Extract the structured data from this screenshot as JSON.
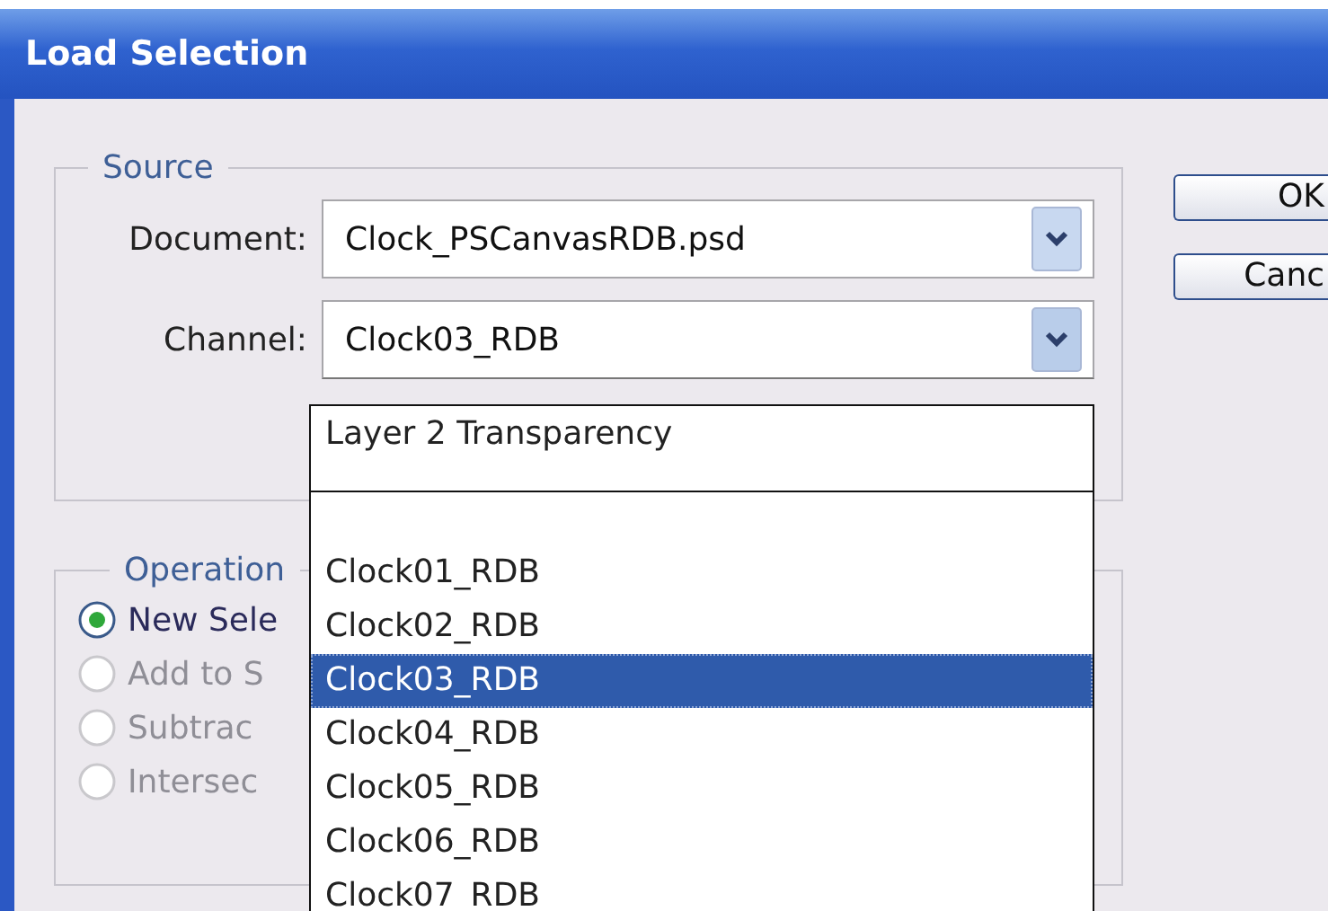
{
  "window": {
    "title": "Load Selection"
  },
  "source": {
    "legend": "Source",
    "document": {
      "label": "Document:",
      "value": "Clock_PSCanvasRDB.psd"
    },
    "channel": {
      "label": "Channel:",
      "value": "Clock03_RDB",
      "expanded": true
    }
  },
  "channel_list": [
    {
      "kind": "item",
      "label": "Layer 2 Transparency",
      "selected": false
    },
    {
      "kind": "separator"
    },
    {
      "kind": "item",
      "label": "Clock01_RDB",
      "selected": false
    },
    {
      "kind": "item",
      "label": "Clock02_RDB",
      "selected": false
    },
    {
      "kind": "item",
      "label": "Clock03_RDB",
      "selected": true
    },
    {
      "kind": "item",
      "label": "Clock04_RDB",
      "selected": false
    },
    {
      "kind": "item",
      "label": "Clock05_RDB",
      "selected": false
    },
    {
      "kind": "item",
      "label": "Clock06_RDB",
      "selected": false
    },
    {
      "kind": "item",
      "label": "Clock07_RDB",
      "selected": false
    }
  ],
  "operation": {
    "legend": "Operation",
    "options": [
      {
        "label": "New Sele",
        "selected": true,
        "disabled": false
      },
      {
        "label": "Add to S",
        "selected": false,
        "disabled": true
      },
      {
        "label": "Subtrac",
        "selected": false,
        "disabled": true
      },
      {
        "label": "Intersec",
        "selected": false,
        "disabled": true
      }
    ]
  },
  "buttons": [
    "OK",
    "Canc"
  ]
}
